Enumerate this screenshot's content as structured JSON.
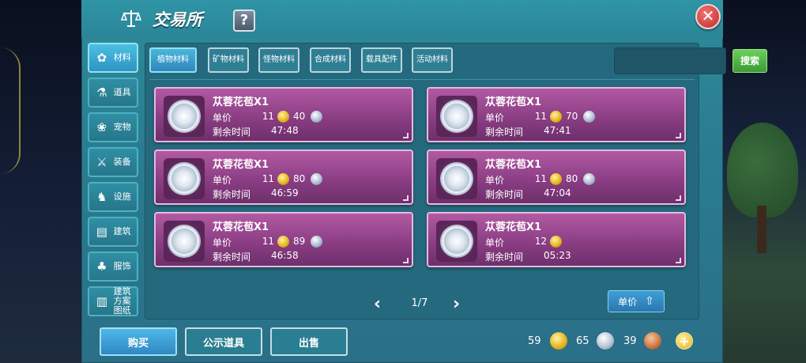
{
  "window": {
    "title": "交易所",
    "help_label": "?",
    "close_label": "✕"
  },
  "sidebar": {
    "items": [
      {
        "label": "材料",
        "icon": "materials-icon",
        "active": true
      },
      {
        "label": "道具",
        "icon": "potion-icon",
        "active": false
      },
      {
        "label": "宠物",
        "icon": "paw-icon",
        "active": false
      },
      {
        "label": "装备",
        "icon": "equipment-icon",
        "active": false
      },
      {
        "label": "设施",
        "icon": "facility-icon",
        "active": false
      },
      {
        "label": "建筑",
        "icon": "building-icon",
        "active": false
      },
      {
        "label": "服饰",
        "icon": "clothing-icon",
        "active": false
      },
      {
        "label": "建筑方案图纸",
        "icon": "blueprint-icon",
        "active": false
      }
    ]
  },
  "tabs": [
    {
      "label": "植物材料",
      "active": true
    },
    {
      "label": "矿物材料",
      "active": false
    },
    {
      "label": "怪物材料",
      "active": false
    },
    {
      "label": "合成材料",
      "active": false
    },
    {
      "label": "载具配件",
      "active": false
    },
    {
      "label": "活动材料",
      "active": false
    }
  ],
  "search": {
    "placeholder": "",
    "button_label": "搜索"
  },
  "listing_labels": {
    "price": "单价",
    "time": "剩余时间"
  },
  "listings": [
    {
      "name": "苁蓉花苞X1",
      "price_gold": "11",
      "price_silver": "40",
      "time": "47:48"
    },
    {
      "name": "苁蓉花苞X1",
      "price_gold": "11",
      "price_silver": "70",
      "time": "47:41"
    },
    {
      "name": "苁蓉花苞X1",
      "price_gold": "11",
      "price_silver": "80",
      "time": "46:59"
    },
    {
      "name": "苁蓉花苞X1",
      "price_gold": "11",
      "price_silver": "80",
      "time": "47:04"
    },
    {
      "name": "苁蓉花苞X1",
      "price_gold": "11",
      "price_silver": "89",
      "time": "46:58"
    },
    {
      "name": "苁蓉花苞X1",
      "price_gold": "12",
      "price_silver": null,
      "time": "05:23"
    }
  ],
  "pager": {
    "text": "1/7",
    "prev": "‹",
    "next": "›"
  },
  "sort": {
    "label": "单价",
    "icon": "sort-arrow-icon"
  },
  "actions": {
    "buy": "购买",
    "public": "公示道具",
    "sell": "出售"
  },
  "currency": {
    "gold": "59",
    "silver": "65",
    "copper": "39",
    "add_label": "+"
  },
  "colors": {
    "panel": "#2a7d90",
    "card": "#8b3e84",
    "accent": "#2e88c2",
    "search_green": "#3c9a34"
  }
}
